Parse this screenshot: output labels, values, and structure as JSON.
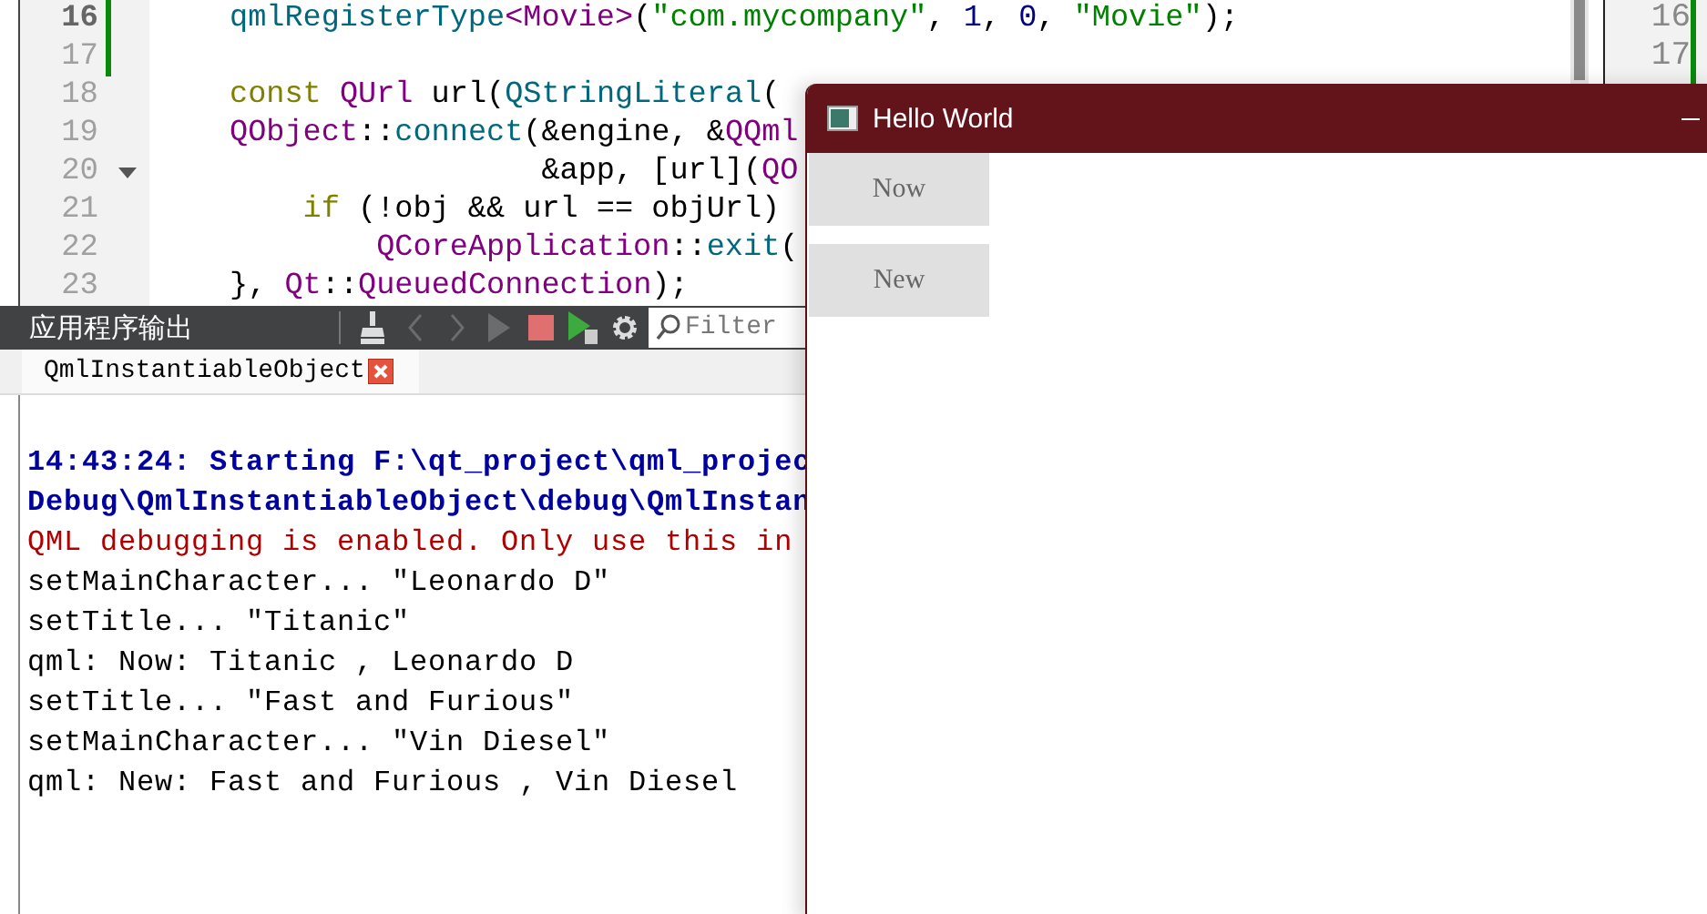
{
  "editor": {
    "lines": [
      {
        "number": "16",
        "current": true,
        "changed": true,
        "foldable": false,
        "tokens": [
          {
            "kind": "func",
            "text": "qmlRegisterType"
          },
          {
            "kind": "type",
            "text": "<Movie>"
          },
          {
            "kind": "plain",
            "text": "("
          },
          {
            "kind": "string",
            "text": "\"com.mycompany\""
          },
          {
            "kind": "plain",
            "text": ", "
          },
          {
            "kind": "number",
            "text": "1"
          },
          {
            "kind": "plain",
            "text": ", "
          },
          {
            "kind": "number",
            "text": "0"
          },
          {
            "kind": "plain",
            "text": ", "
          },
          {
            "kind": "string",
            "text": "\"Movie\""
          },
          {
            "kind": "plain",
            "text": ");"
          }
        ]
      },
      {
        "number": "17",
        "current": false,
        "changed": true,
        "foldable": false
      },
      {
        "number": "18",
        "current": false,
        "changed": false,
        "foldable": false,
        "tokens": [
          {
            "kind": "keyword",
            "text": "const "
          },
          {
            "kind": "type",
            "text": "QUrl"
          },
          {
            "kind": "plain",
            "text": " url("
          },
          {
            "kind": "func",
            "text": "QStringLiteral"
          },
          {
            "kind": "plain",
            "text": "("
          }
        ]
      },
      {
        "number": "19",
        "current": false,
        "changed": false,
        "foldable": false,
        "tokens": [
          {
            "kind": "type",
            "text": "QObject"
          },
          {
            "kind": "plain",
            "text": "::"
          },
          {
            "kind": "func",
            "text": "connect"
          },
          {
            "kind": "plain",
            "text": "(&engine, &"
          },
          {
            "kind": "type",
            "text": "QQml"
          }
        ]
      },
      {
        "number": "20",
        "current": false,
        "changed": false,
        "foldable": true,
        "tokens": [
          {
            "kind": "plain",
            "text": "                 &app, [url]("
          },
          {
            "kind": "type",
            "text": "QO"
          }
        ]
      },
      {
        "number": "21",
        "current": false,
        "changed": false,
        "foldable": false,
        "tokens": [
          {
            "kind": "keyword",
            "text": "    if"
          },
          {
            "kind": "plain",
            "text": " (!obj && url == objUrl)"
          }
        ]
      },
      {
        "number": "22",
        "current": false,
        "changed": false,
        "foldable": false,
        "tokens": [
          {
            "kind": "type",
            "text": "        QCoreApplication"
          },
          {
            "kind": "plain",
            "text": "::"
          },
          {
            "kind": "func",
            "text": "exit"
          },
          {
            "kind": "plain",
            "text": "("
          }
        ]
      },
      {
        "number": "23",
        "current": false,
        "changed": false,
        "foldable": false,
        "tokens": [
          {
            "kind": "plain",
            "text": "}, "
          },
          {
            "kind": "type",
            "text": "Qt"
          },
          {
            "kind": "plain",
            "text": "::"
          },
          {
            "kind": "type",
            "text": "QueuedConnection"
          },
          {
            "kind": "plain",
            "text": ");"
          }
        ]
      }
    ]
  },
  "side_editor": {
    "line_numbers": [
      "16",
      "17"
    ]
  },
  "output_pane": {
    "title": "应用程序输出",
    "toolbar": [
      {
        "kind": "clear",
        "disabled": false
      },
      {
        "kind": "prev",
        "disabled": true
      },
      {
        "kind": "next",
        "disabled": true
      },
      {
        "kind": "run",
        "disabled": true
      },
      {
        "kind": "stop",
        "disabled": false
      },
      {
        "kind": "rerun",
        "disabled": false
      },
      {
        "kind": "settings",
        "disabled": false
      }
    ],
    "filter": {
      "placeholder": "Filter"
    },
    "tabs": [
      {
        "label": "QmlInstantiableObject",
        "selected": true
      }
    ],
    "lines": [
      {
        "kind": "start",
        "text": "14:43:24: Starting F:\\qt_project\\qml_projec"
      },
      {
        "kind": "start",
        "text": "Debug\\QmlInstantiableObject\\debug\\QmlInstan"
      },
      {
        "kind": "warning",
        "text": "QML debugging is enabled. Only use this in"
      },
      {
        "kind": "plain",
        "text": "setMainCharacter... \"Leonardo D\""
      },
      {
        "kind": "plain",
        "text": "setTitle... \"Titanic\""
      },
      {
        "kind": "plain",
        "text": "qml: Now: Titanic , Leonardo D"
      },
      {
        "kind": "plain",
        "text": "setTitle... \"Fast and Furious\""
      },
      {
        "kind": "plain",
        "text": "setMainCharacter... \"Vin Diesel\""
      },
      {
        "kind": "plain",
        "text": "qml: New: Fast and Furious , Vin Diesel"
      }
    ]
  },
  "app_window": {
    "title": "Hello World",
    "buttons": [
      "Now",
      "New"
    ]
  }
}
